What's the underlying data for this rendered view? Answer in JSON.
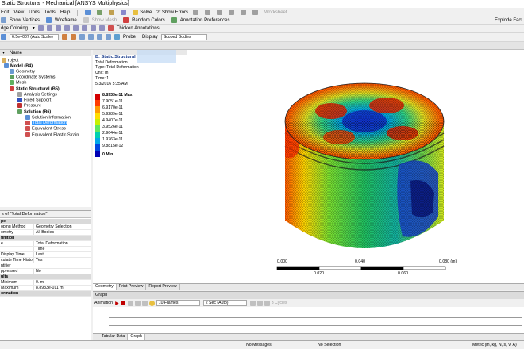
{
  "window": {
    "title": "Static Structural - Mechanical [ANSYS Multiphysics]"
  },
  "menu": [
    "Edit",
    "View",
    "Units",
    "Tools",
    "Help"
  ],
  "toolbar1": {
    "solve": "Solve",
    "show_errors": "?/ Show Errors",
    "worksheet": "Worksheet"
  },
  "toolbar2": {
    "show_vertices": "Show Vertices",
    "wireframe": "Wireframe",
    "show_mesh": "Show Mesh",
    "random_colors": "Random Colors",
    "annotation_preferences": "Annotation Preferences",
    "explode": "Explode Fact"
  },
  "toolbar3": {
    "edge_coloring": "dge Coloring",
    "thicken_annotations": "Thicken Annotations"
  },
  "toolbar4": {
    "scale": "6.5e+007 (Auto Scale)",
    "probe": "Probe",
    "display": "Display",
    "scoped_bodies": "Scoped Bodies"
  },
  "outline": {
    "column_header": "Name",
    "items": [
      {
        "label": "roject"
      },
      {
        "label": "Model (B4)"
      },
      {
        "label": "Geometry"
      },
      {
        "label": "Coordinate Systems"
      },
      {
        "label": "Mesh"
      },
      {
        "label": "Static Structural (B5)"
      },
      {
        "label": "Analysis Settings"
      },
      {
        "label": "Fixed Support"
      },
      {
        "label": "Pressure"
      },
      {
        "label": "Solution (B6)"
      },
      {
        "label": "Solution Information"
      },
      {
        "label": "Total Deformation"
      },
      {
        "label": "Equivalent Stress"
      },
      {
        "label": "Equivalent Elastic Strain"
      }
    ]
  },
  "details": {
    "title": "s of \"Total Deformation\"",
    "rows": [
      {
        "k": "pe",
        "v": "",
        "section": true
      },
      {
        "k": "oping Method",
        "v": "Geometry Selection"
      },
      {
        "k": "ometry",
        "v": "All Bodies"
      },
      {
        "k": "finition",
        "v": "",
        "section": true
      },
      {
        "k": "e",
        "v": "Total Deformation"
      },
      {
        "k": "",
        "v": "Time"
      },
      {
        "k": "Display Time",
        "v": "Last"
      },
      {
        "k": "culate Time History",
        "v": "Yes"
      },
      {
        "k": "ntifier",
        "v": ""
      },
      {
        "k": "ppressed",
        "v": "No"
      },
      {
        "k": "ults",
        "v": "",
        "section": true
      },
      {
        "k": "Minimum",
        "v": "0. m"
      },
      {
        "k": "Maximum",
        "v": "8.8933e-011 m"
      },
      {
        "k": "ormation",
        "v": "",
        "section": true
      }
    ]
  },
  "viewport": {
    "header": {
      "line1": "B: Static Structural",
      "line2": "Total Deformation",
      "line3": "Type: Total Deformation",
      "line4": "Unit: m",
      "line5": "Time: 1",
      "line6": "5/3/2016 5:35 AM"
    },
    "legend": {
      "labels": [
        "8.8933e-11 Max",
        "7.9051e-11",
        "6.9170e-11",
        "5.9289e-11",
        "4.9407e-11",
        "3.9526e-11",
        "2.9644e-11",
        "1.9763e-11",
        "9.8815e-12",
        "0 Min"
      ],
      "colors": [
        "#d40000",
        "#ff3c00",
        "#ff9a00",
        "#ffdd00",
        "#c8f000",
        "#5ee85e",
        "#00d0b0",
        "#00a8e8",
        "#0046e0",
        "#0000b4"
      ]
    },
    "scale": {
      "top_labels": [
        "0.000",
        "0.040",
        "0.080 (m)"
      ],
      "bottom_labels": [
        "0.020",
        "0.060"
      ]
    }
  },
  "tabs": [
    "Geometry",
    "Print Preview",
    "Report Preview"
  ],
  "graph": {
    "title": "Graph",
    "animation": "Animation",
    "frames": "10 Frames",
    "duration": "2 Sec (Auto)",
    "cycles": "3 Cycles"
  },
  "bottom_tabs": [
    "Tabular Data",
    "Graph"
  ],
  "status": {
    "messages": "No Messages",
    "selection": "No Selection",
    "units": "Metric (m, kg, N, s, V, A)"
  }
}
